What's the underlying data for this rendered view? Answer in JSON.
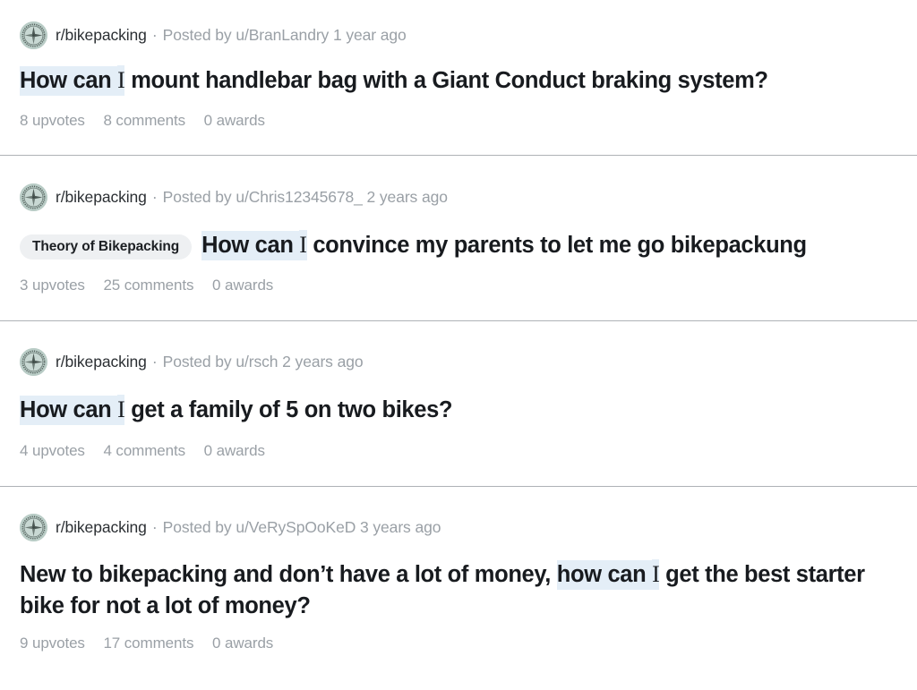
{
  "colors": {
    "highlight": "#e4eef7",
    "flair_bg": "#eef0f2",
    "avatar_bg": "#b9ccc6",
    "divider": "#aeb2b6",
    "title_text": "#181b1f",
    "muted_text": "#9aa0a6",
    "subreddit_text": "#2b2f33"
  },
  "separator": "·",
  "posts": [
    {
      "avatar_icon": "compass-rose-icon",
      "subreddit": "r/bikepacking",
      "byline": "Posted by u/BranLandry 1 year ago",
      "flair": null,
      "title_parts": [
        {
          "text": "How can ",
          "highlight": true,
          "serif": false
        },
        {
          "text": "I",
          "highlight": true,
          "serif": true
        },
        {
          "text": " mount handlebar bag with a Giant Conduct braking system?",
          "highlight": false,
          "serif": false
        }
      ],
      "title_plain": "How can I mount handlebar bag with a Giant Conduct braking system?",
      "upvotes": "8 upvotes",
      "comments": "8 comments",
      "awards": "0 awards"
    },
    {
      "avatar_icon": "compass-rose-icon",
      "subreddit": "r/bikepacking",
      "byline": "Posted by u/Chris12345678_ 2 years ago",
      "flair": "Theory of Bikepacking",
      "title_parts": [
        {
          "text": "How can ",
          "highlight": true,
          "serif": false
        },
        {
          "text": "I",
          "highlight": true,
          "serif": true
        },
        {
          "text": " convince my parents to let me go bikepackung",
          "highlight": false,
          "serif": false
        }
      ],
      "title_plain": "How can I convince my parents to let me go bikepackung",
      "upvotes": "3 upvotes",
      "comments": "25 comments",
      "awards": "0 awards"
    },
    {
      "avatar_icon": "compass-rose-icon",
      "subreddit": "r/bikepacking",
      "byline": "Posted by u/rsch 2 years ago",
      "flair": null,
      "title_parts": [
        {
          "text": "How can ",
          "highlight": true,
          "serif": false
        },
        {
          "text": "I",
          "highlight": true,
          "serif": true
        },
        {
          "text": " get a family of 5 on two bikes?",
          "highlight": false,
          "serif": false
        }
      ],
      "title_plain": "How can I get a family of 5 on two bikes?",
      "upvotes": "4 upvotes",
      "comments": "4 comments",
      "awards": "0 awards"
    },
    {
      "avatar_icon": "compass-rose-icon",
      "subreddit": "r/bikepacking",
      "byline": "Posted by u/VeRySpOoKeD 3 years ago",
      "flair": null,
      "title_parts": [
        {
          "text": "New to bikepacking and don’t have a lot of money, ",
          "highlight": false,
          "serif": false
        },
        {
          "text": "how can ",
          "highlight": true,
          "serif": false
        },
        {
          "text": "I",
          "highlight": true,
          "serif": true
        },
        {
          "text": " get the best starter bike for not a lot of money?",
          "highlight": false,
          "serif": false
        }
      ],
      "title_plain": "New to bikepacking and don’t have a lot of money, how can I get the best starter bike for not a lot of money?",
      "upvotes": "9 upvotes",
      "comments": "17 comments",
      "awards": "0 awards"
    }
  ]
}
